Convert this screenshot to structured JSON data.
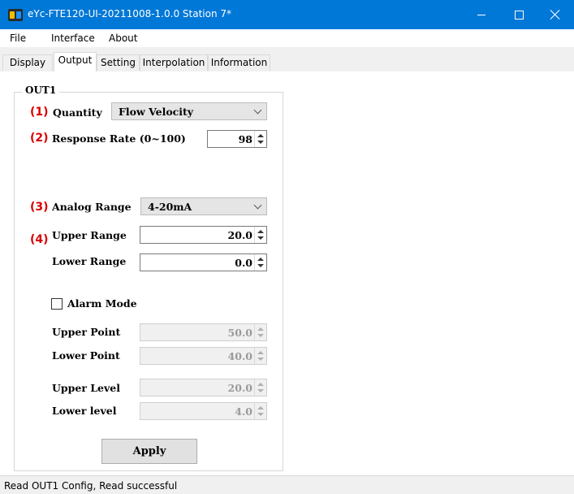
{
  "window": {
    "title": "eYc-FTE120-UI-20211008-1.0.0  Station 7*",
    "colors": {
      "titlebar": "#0078d7",
      "accent_number": "#d80000"
    }
  },
  "menu": {
    "items": [
      "File",
      "Interface",
      "About"
    ]
  },
  "tabs": {
    "items": [
      "Display",
      "Output",
      "Setting",
      "Interpolation",
      "Information"
    ],
    "active": "Output"
  },
  "group": {
    "title": "OUT1",
    "markers": [
      "(1)",
      "(2)",
      "(3)",
      "(4)"
    ],
    "quantity": {
      "label": "Quantity",
      "value": "Flow Velocity"
    },
    "response_rate": {
      "label": "Response Rate (0~100)",
      "value": "98"
    },
    "analog_range": {
      "label": "Analog Range",
      "value": "4-20mA"
    },
    "upper_range": {
      "label": "Upper Range",
      "value": "20.0"
    },
    "lower_range": {
      "label": "Lower Range",
      "value": "0.0"
    },
    "alarm_mode": {
      "label": "Alarm Mode",
      "checked": false
    },
    "upper_point": {
      "label": "Upper Point",
      "value": "50.0"
    },
    "lower_point": {
      "label": "Lower Point",
      "value": "40.0"
    },
    "upper_level": {
      "label": "Upper Level",
      "value": "20.0"
    },
    "lower_level": {
      "label": "Lower level",
      "value": "4.0"
    },
    "apply_label": "Apply"
  },
  "status": {
    "text": "Read OUT1 Config,   Read successful"
  }
}
